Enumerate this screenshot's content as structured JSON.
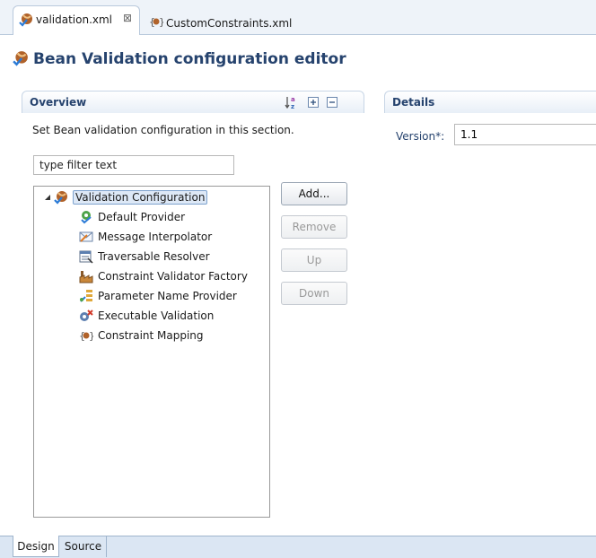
{
  "tabs": {
    "active_label": "validation.xml",
    "close_glyph": "⊠",
    "other_label": "CustomConstraints.xml"
  },
  "editor": {
    "title": "Bean Validation configuration editor"
  },
  "overview": {
    "header": "Overview",
    "sort_icon_text": "a z",
    "description": "Set Bean validation configuration in this section.",
    "filter_placeholder": "type filter text"
  },
  "tree": {
    "root": {
      "label": "Validation Configuration",
      "icon": "bean-validation-icon"
    },
    "items": [
      {
        "label": "Default Provider",
        "icon": "provider-icon"
      },
      {
        "label": "Message Interpolator",
        "icon": "envelope-icon"
      },
      {
        "label": "Traversable Resolver",
        "icon": "resolver-icon"
      },
      {
        "label": "Constraint Validator Factory",
        "icon": "factory-icon"
      },
      {
        "label": "Parameter Name Provider",
        "icon": "parameter-icon"
      },
      {
        "label": "Executable Validation",
        "icon": "executable-icon"
      },
      {
        "label": "Constraint Mapping",
        "icon": "mapping-icon"
      }
    ]
  },
  "buttons": {
    "add": "Add...",
    "remove": "Remove",
    "up": "Up",
    "down": "Down"
  },
  "details": {
    "header": "Details",
    "version_label": "Version*:",
    "version_value": "1.1"
  },
  "bottom_tabs": {
    "design": "Design",
    "source": "Source"
  },
  "colors": {
    "accent": "#26436e",
    "tab_bar": "#eef3f9",
    "bottom_bar": "#dbe6f3"
  }
}
